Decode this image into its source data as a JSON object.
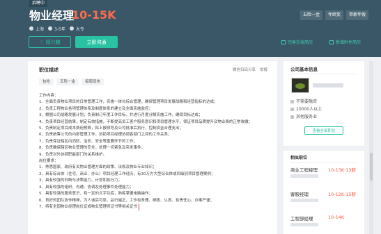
{
  "header": {
    "badge": "招聘中",
    "title": "物业经理",
    "salary": "10-15K",
    "location": "上海",
    "experience": "3-5年",
    "education": "大专",
    "tags": [
      "五险一金",
      "年终奖",
      "带薪年假"
    ],
    "interest_label": "感兴趣",
    "chat_label": "立即沟通",
    "resume_link": "完善在线简历",
    "attach_link": "新增附件简历"
  },
  "main": {
    "title": "职位描述",
    "wechat_share": "微信扫码分享",
    "report": "举报",
    "welfare": [
      "包吃",
      "五险一金",
      "每周双休"
    ],
    "lines": [
      "工作内容：",
      "1、全面负责物业项目的日常管理工作，实施一体化综合管理，确保管理项目发展战略和经营指标的达成；",
      "2、负责工程物业各项管理体系及制度体系的建立及全面实施监控；",
      "3、根据公司战略发展计划，负责制订年度工作目标，并进行月度分解实施工作，确保目标达成；",
      "4、负责项目经营结果，制定有效措施，不断提高员工客户服务意识和项目管理水平，保证项目品质提升及物业费的正常收缴；",
      "5、负责制定项目成本费用预算，拟上报领导及公司批准后执行，控制资金合理支出；",
      "6、负责统筹公司的内部管理工作，协助项目经理协调各部门之间的工作关系；",
      "7、负责保证辖区内消防、治安、安全等重要环节的工作；",
      "8、负责确保辖区物业管理的安全，处理一切紧急及突发事件；",
      "9、负责对外协调职能部门的关系维护。",
      "岗位要求：",
      "1、熟悉国家、政府有关物业管理方面的政策、法规及物业专业知识；",
      "2、具有综合体（住宅、商业、办公）项目经理工作经历，有30万方大型综合体或同级别项目管理案例；",
      "3、具有较强的判断与决策能力、计划和执行力；",
      "4、具有较强的组织、沟通、协调及处理事件处理能力；",
      "5、具有较强的服务意识、有一定的文字功底，熟练掌握电脑操作；",
      "6、良好的团队协作精神，为人诚实可靠、品行端正，工作有条理、细致、认真、有责任心，办事严谨；",
      "7、持有全国物业经理岗位证或物业管理师证书等相关证书"
    ]
  },
  "company": {
    "caption": "公司基本信息",
    "funding": "不需要融资",
    "size": "10000人以上",
    "industry": "其他服务业",
    "all_jobs_label": "查看全部职位"
  },
  "related": {
    "caption": "相似职位",
    "jobs": [
      {
        "title": "商业工程经理",
        "salary": "10-13K·13薪"
      },
      {
        "title": "客服经理",
        "salary": "10-12K·15薪"
      },
      {
        "title": "工程部经理",
        "salary": "10-14K"
      }
    ]
  }
}
